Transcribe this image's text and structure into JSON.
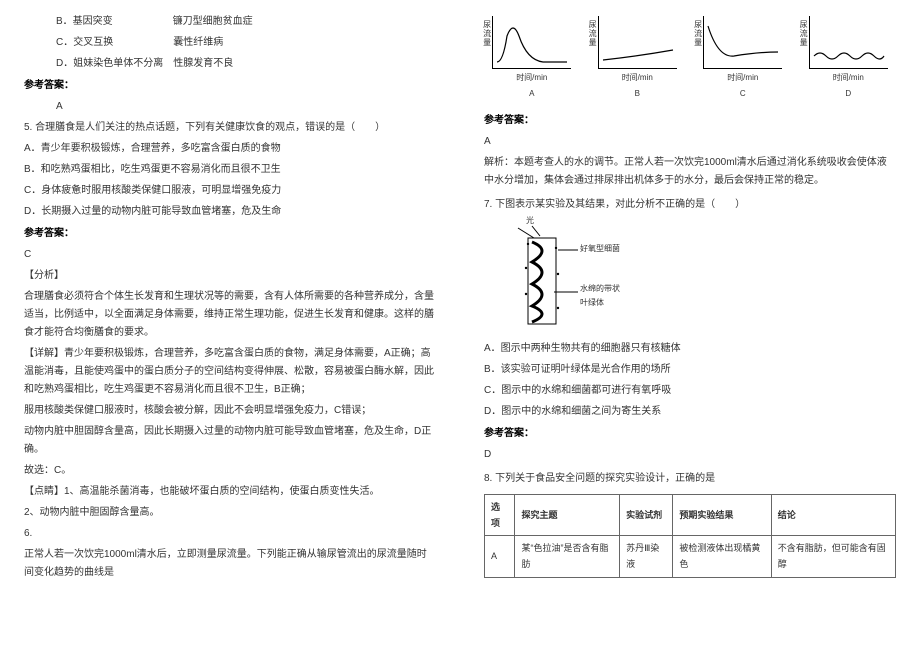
{
  "left": {
    "optB": "B．基因突变　　　　　　镰刀型细胞贫血症",
    "optC": "C．交叉互换　　　　　　囊性纤维病",
    "optD": "D．姐妹染色单体不分离　性腺发育不良",
    "ansHdr": "参考答案：",
    "ansA": "A",
    "q5": "5. 合理膳食是人们关注的热点话题，下列有关健康饮食的观点，错误的是（　　）",
    "q5a": "A．青少年要积极锻炼，合理营养，多吃富含蛋白质的食物",
    "q5b": "B．和吃熟鸡蛋相比，吃生鸡蛋更不容易消化而且很不卫生",
    "q5c": "C．身体疲惫时服用核酸类保健口服液，可明显增强免疫力",
    "q5d": "D．长期摄入过量的动物内脏可能导致血管堵塞，危及生命",
    "ansC": "C",
    "fenxi": "【分析】",
    "fenxiTxt": "合理膳食必须符合个体生长发育和生理状况等的需要，含有人体所需要的各种营养成分，含量适当，比例适中，以全面满足身体需要，维持正常生理功能，促进生长发育和健康。这样的膳食才能符合均衡膳食的要求。",
    "xiangjie": "【详解】青少年要积极锻炼，合理营养，多吃富含蛋白质的食物，满足身体需要，A正确；高温能消毒，且能使鸡蛋中的蛋白质分子的空间结构变得伸展、松散，容易被蛋白酶水解，因此和吃熟鸡蛋相比，吃生鸡蛋更不容易消化而且很不卫生，B正确；",
    "xiangjie2": "服用核酸类保健口服液时，核酸会被分解，因此不会明显增强免疫力，C错误；",
    "xiangjie3": "动物内脏中胆固醇含量高，因此长期摄入过量的动物内脏可能导致血管堵塞，危及生命，D正确。",
    "guxuan": "故选：C。",
    "dianjin": "【点睛】1、高温能杀菌消毒，也能破坏蛋白质的空间结构，使蛋白质变性失活。",
    "dianjin2": "2、动物内脏中胆固醇含量高。",
    "q6": "6.",
    "q6txt": "正常人若一次饮完1000ml清水后，立即测量尿流量。下列能正确从输尿管流出的尿流量随时间变化趋势的曲线是"
  },
  "right": {
    "graph": {
      "xlabel": "时间/min",
      "ylabel": "尿流量",
      "labels": [
        "A",
        "B",
        "C",
        "D"
      ]
    },
    "ansHdr": "参考答案：",
    "ansA": "A",
    "jiexi": "解析：本题考查人的水的调节。正常人若一次饮完1000ml清水后通过消化系统吸收会使体液中水分增加，集体会通过排尿排出机体多于的水分，最后会保持正常的稳定。",
    "q7": "7. 下图表示某实验及其结果，对此分析不正确的是（　　）",
    "diagram": {
      "light": "光",
      "haoyang": "好氧型细菌",
      "shuimian": "水绵的带状叶绿体"
    },
    "q7a": "A．图示中两种生物共有的细胞器只有核糖体",
    "q7b": "B．该实验可证明叶绿体是光合作用的场所",
    "q7c": "C．图示中的水绵和细菌都可进行有氧呼吸",
    "q7d": "D．图示中的水绵和细菌之间为寄生关系",
    "ansD": "D",
    "q8": "8. 下列关于食品安全问题的探究实验设计，正确的是",
    "table": {
      "headers": [
        "选项",
        "探究主题",
        "实验试剂",
        "预期实验结果",
        "结论"
      ],
      "row": [
        "A",
        "某“色拉油”是否含有脂肪",
        "苏丹Ⅲ染液",
        "被检测液体出现橘黄色",
        "不含有脂肪，但可能含有固醇"
      ]
    }
  }
}
